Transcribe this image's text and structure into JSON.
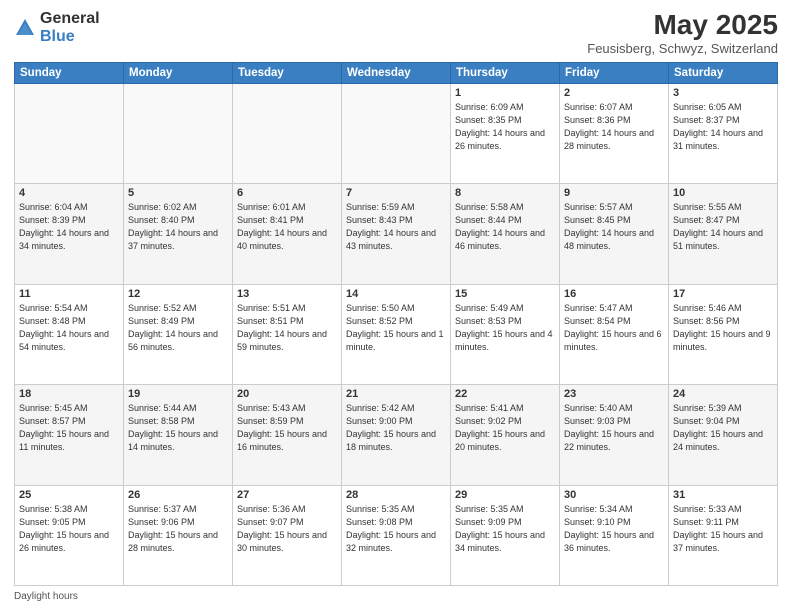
{
  "logo": {
    "general": "General",
    "blue": "Blue"
  },
  "title": "May 2025",
  "subtitle": "Feusisberg, Schwyz, Switzerland",
  "days_of_week": [
    "Sunday",
    "Monday",
    "Tuesday",
    "Wednesday",
    "Thursday",
    "Friday",
    "Saturday"
  ],
  "footer": "Daylight hours",
  "weeks": [
    [
      {
        "day": "",
        "info": ""
      },
      {
        "day": "",
        "info": ""
      },
      {
        "day": "",
        "info": ""
      },
      {
        "day": "",
        "info": ""
      },
      {
        "day": "1",
        "info": "Sunrise: 6:09 AM\nSunset: 8:35 PM\nDaylight: 14 hours and 26 minutes."
      },
      {
        "day": "2",
        "info": "Sunrise: 6:07 AM\nSunset: 8:36 PM\nDaylight: 14 hours and 28 minutes."
      },
      {
        "day": "3",
        "info": "Sunrise: 6:05 AM\nSunset: 8:37 PM\nDaylight: 14 hours and 31 minutes."
      }
    ],
    [
      {
        "day": "4",
        "info": "Sunrise: 6:04 AM\nSunset: 8:39 PM\nDaylight: 14 hours and 34 minutes."
      },
      {
        "day": "5",
        "info": "Sunrise: 6:02 AM\nSunset: 8:40 PM\nDaylight: 14 hours and 37 minutes."
      },
      {
        "day": "6",
        "info": "Sunrise: 6:01 AM\nSunset: 8:41 PM\nDaylight: 14 hours and 40 minutes."
      },
      {
        "day": "7",
        "info": "Sunrise: 5:59 AM\nSunset: 8:43 PM\nDaylight: 14 hours and 43 minutes."
      },
      {
        "day": "8",
        "info": "Sunrise: 5:58 AM\nSunset: 8:44 PM\nDaylight: 14 hours and 46 minutes."
      },
      {
        "day": "9",
        "info": "Sunrise: 5:57 AM\nSunset: 8:45 PM\nDaylight: 14 hours and 48 minutes."
      },
      {
        "day": "10",
        "info": "Sunrise: 5:55 AM\nSunset: 8:47 PM\nDaylight: 14 hours and 51 minutes."
      }
    ],
    [
      {
        "day": "11",
        "info": "Sunrise: 5:54 AM\nSunset: 8:48 PM\nDaylight: 14 hours and 54 minutes."
      },
      {
        "day": "12",
        "info": "Sunrise: 5:52 AM\nSunset: 8:49 PM\nDaylight: 14 hours and 56 minutes."
      },
      {
        "day": "13",
        "info": "Sunrise: 5:51 AM\nSunset: 8:51 PM\nDaylight: 14 hours and 59 minutes."
      },
      {
        "day": "14",
        "info": "Sunrise: 5:50 AM\nSunset: 8:52 PM\nDaylight: 15 hours and 1 minute."
      },
      {
        "day": "15",
        "info": "Sunrise: 5:49 AM\nSunset: 8:53 PM\nDaylight: 15 hours and 4 minutes."
      },
      {
        "day": "16",
        "info": "Sunrise: 5:47 AM\nSunset: 8:54 PM\nDaylight: 15 hours and 6 minutes."
      },
      {
        "day": "17",
        "info": "Sunrise: 5:46 AM\nSunset: 8:56 PM\nDaylight: 15 hours and 9 minutes."
      }
    ],
    [
      {
        "day": "18",
        "info": "Sunrise: 5:45 AM\nSunset: 8:57 PM\nDaylight: 15 hours and 11 minutes."
      },
      {
        "day": "19",
        "info": "Sunrise: 5:44 AM\nSunset: 8:58 PM\nDaylight: 15 hours and 14 minutes."
      },
      {
        "day": "20",
        "info": "Sunrise: 5:43 AM\nSunset: 8:59 PM\nDaylight: 15 hours and 16 minutes."
      },
      {
        "day": "21",
        "info": "Sunrise: 5:42 AM\nSunset: 9:00 PM\nDaylight: 15 hours and 18 minutes."
      },
      {
        "day": "22",
        "info": "Sunrise: 5:41 AM\nSunset: 9:02 PM\nDaylight: 15 hours and 20 minutes."
      },
      {
        "day": "23",
        "info": "Sunrise: 5:40 AM\nSunset: 9:03 PM\nDaylight: 15 hours and 22 minutes."
      },
      {
        "day": "24",
        "info": "Sunrise: 5:39 AM\nSunset: 9:04 PM\nDaylight: 15 hours and 24 minutes."
      }
    ],
    [
      {
        "day": "25",
        "info": "Sunrise: 5:38 AM\nSunset: 9:05 PM\nDaylight: 15 hours and 26 minutes."
      },
      {
        "day": "26",
        "info": "Sunrise: 5:37 AM\nSunset: 9:06 PM\nDaylight: 15 hours and 28 minutes."
      },
      {
        "day": "27",
        "info": "Sunrise: 5:36 AM\nSunset: 9:07 PM\nDaylight: 15 hours and 30 minutes."
      },
      {
        "day": "28",
        "info": "Sunrise: 5:35 AM\nSunset: 9:08 PM\nDaylight: 15 hours and 32 minutes."
      },
      {
        "day": "29",
        "info": "Sunrise: 5:35 AM\nSunset: 9:09 PM\nDaylight: 15 hours and 34 minutes."
      },
      {
        "day": "30",
        "info": "Sunrise: 5:34 AM\nSunset: 9:10 PM\nDaylight: 15 hours and 36 minutes."
      },
      {
        "day": "31",
        "info": "Sunrise: 5:33 AM\nSunset: 9:11 PM\nDaylight: 15 hours and 37 minutes."
      }
    ]
  ]
}
